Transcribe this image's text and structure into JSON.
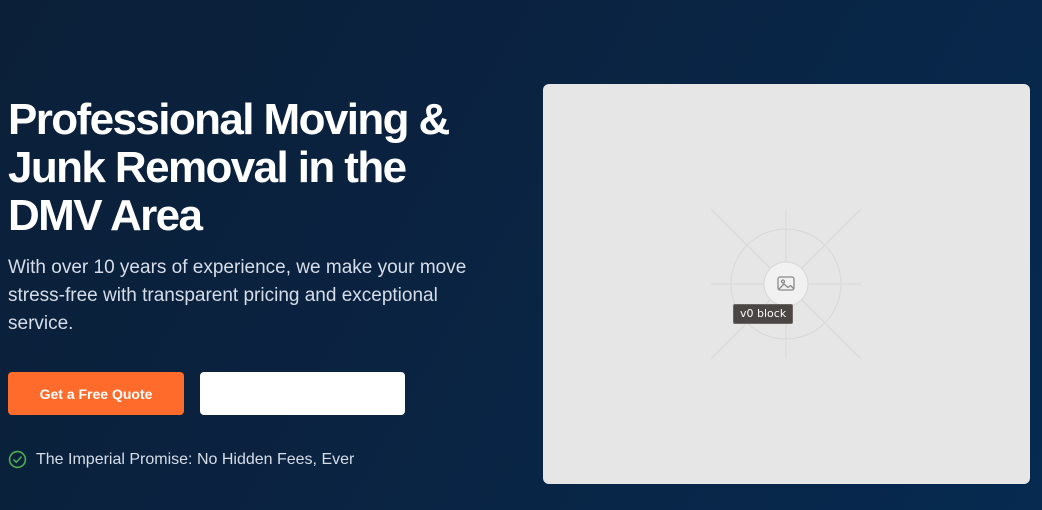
{
  "hero": {
    "headline": "Professional Moving & Junk Removal in the DMV Area",
    "subtext": "With over 10 years of experience, we make your move stress-free with transparent pricing and exceptional service.",
    "primary_button_label": "Get a Free Quote",
    "secondary_button_label": "",
    "promise_text": "The Imperial Promise: No Hidden Fees, Ever",
    "promise_icon": "check-circle-icon"
  },
  "image_placeholder": {
    "icon": "image-icon",
    "badge_label": "v0 block"
  },
  "colors": {
    "background": "#0a2341",
    "accent": "#ff6b2b",
    "check": "#4caf50",
    "panel": "#e6e6e6"
  }
}
